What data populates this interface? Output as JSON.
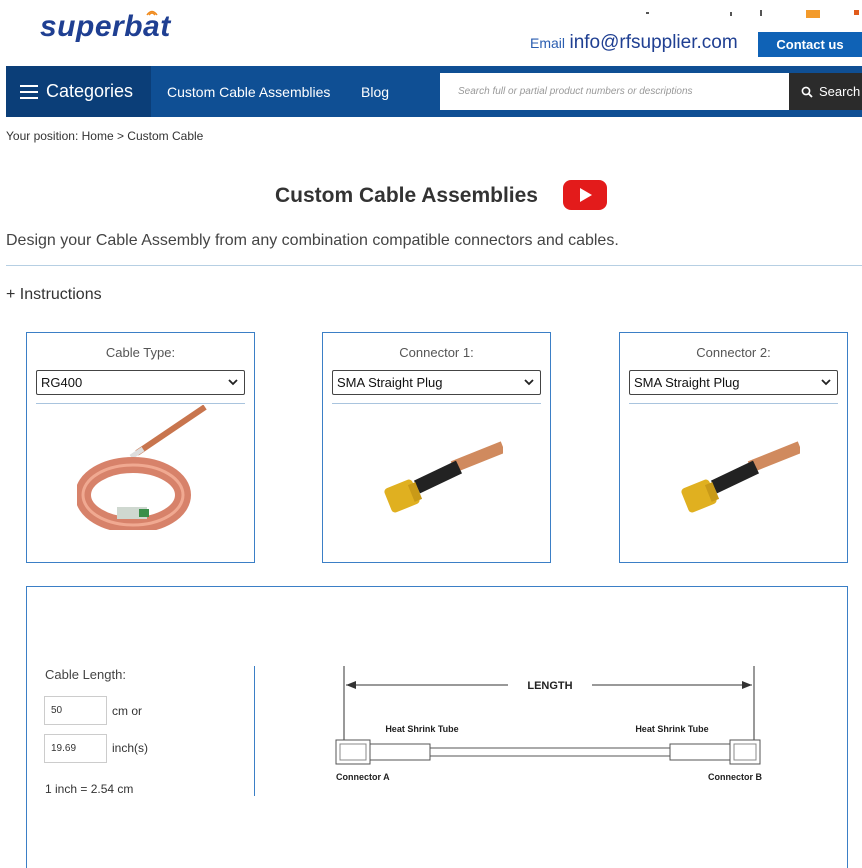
{
  "header": {
    "logo": "superbat",
    "email_label": "Email",
    "email": "info@rfsupplier.com",
    "contact_button": "Contact us"
  },
  "nav": {
    "categories": "Categories",
    "links": [
      "Custom Cable Assemblies",
      "Blog"
    ],
    "search_placeholder": "Search full or partial product numbers or descriptions",
    "search_button": "Search"
  },
  "breadcrumb": "Your position: Home > Custom Cable",
  "page": {
    "title": "Custom Cable Assemblies",
    "intro": "Design your Cable Assembly from any combination compatible connectors and cables.",
    "instructions": "+  Instructions"
  },
  "cards": [
    {
      "label": "Cable Type:",
      "value": "RG400",
      "image": "rg400-cable-coil"
    },
    {
      "label": "Connector 1:",
      "value": "SMA Straight Plug",
      "image": "sma-straight-plug"
    },
    {
      "label": "Connector 2:",
      "value": "SMA Straight Plug",
      "image": "sma-straight-plug"
    }
  ],
  "length": {
    "label": "Cable Length:",
    "cm_value": "50",
    "cm_unit": "cm or",
    "inch_value": "19.69",
    "inch_unit": "inch(s)",
    "conversion": "1 inch = 2.54 cm"
  },
  "diagram": {
    "length": "LENGTH",
    "heat_shrink_left": "Heat Shrink Tube",
    "heat_shrink_right": "Heat Shrink Tube",
    "connector_a": "Connector A",
    "connector_b": "Connector B"
  },
  "colors": {
    "brand": "#1f3f92",
    "nav": "#0f4f94",
    "card_border": "#3b7fc6",
    "youtube": "#e31b1b"
  }
}
